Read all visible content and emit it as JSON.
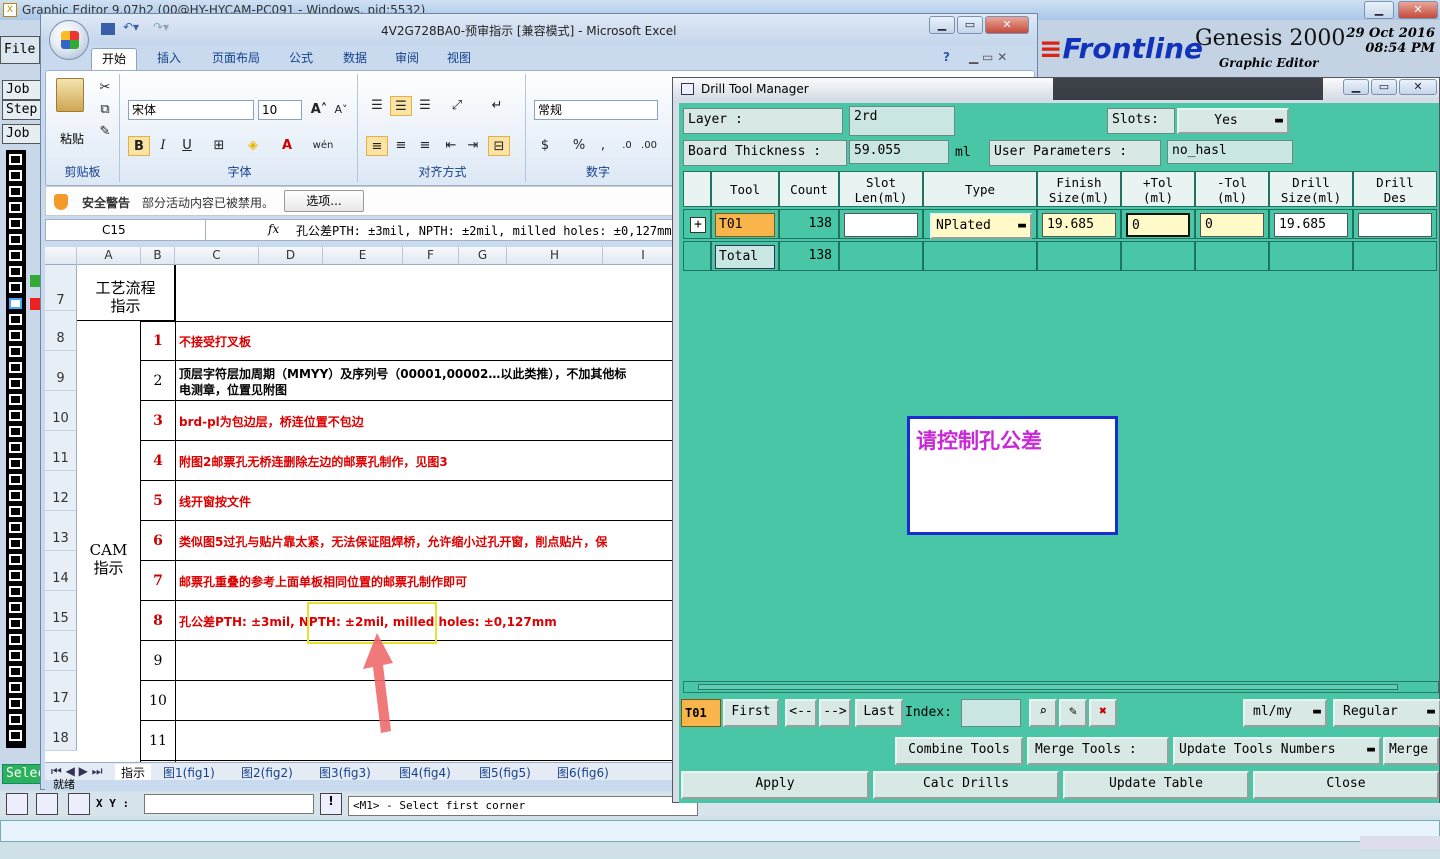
{
  "genesis": {
    "title": "Graphic Editor 9.07h2 (00@HY-HYCAM-PC091 - Windows, pid:5532)",
    "left_buttons": [
      "File",
      "Job",
      "Step",
      "Job",
      "Selec"
    ],
    "logo_brand": "Frontline",
    "logo_product": "Genesis 2000",
    "logo_sub": "Graphic Editor",
    "date": "29 Oct 2016",
    "time": "08:54 PM",
    "xy_label": "X Y :",
    "message": "<M1> - Select first corner"
  },
  "excel": {
    "title": "4V2G728BA0-预审指示 [兼容模式] - Microsoft Excel",
    "tabs": [
      "开始",
      "插入",
      "页面布局",
      "公式",
      "数据",
      "审阅",
      "视图"
    ],
    "ribbon": {
      "paste": "粘贴",
      "font_name": "宋体",
      "font_size": "10",
      "number_format": "常规",
      "groups": [
        "剪贴板",
        "字体",
        "对齐方式",
        "数字"
      ]
    },
    "security": {
      "label": "安全警告",
      "message": "部分活动内容已被禁用。",
      "options": "选项..."
    },
    "name_box": "C15",
    "formula": "孔公差PTH: ±3mil, NPTH: ±2mil, milled holes: ±0,127mm",
    "columns": [
      "A",
      "B",
      "C",
      "D",
      "E",
      "F",
      "G",
      "H",
      "I"
    ],
    "rows": [
      {
        "n": "7",
        "num": "",
        "text": ""
      },
      {
        "n": "8",
        "num": "1",
        "text": "不接受打叉板"
      },
      {
        "n": "9",
        "num": "2",
        "text": "顶层字符层加周期（MMYY）及序列号（00001,00002…以此类推），不加其他标",
        "text2": "电测章，位置见附图"
      },
      {
        "n": "10",
        "num": "3",
        "text": "brd-pl为包边层，桥连位置不包边"
      },
      {
        "n": "11",
        "num": "4",
        "text": "附图2邮票孔无桥连删除左边的邮票孔制作，见图3"
      },
      {
        "n": "12",
        "num": "5",
        "text": "线开窗按文件"
      },
      {
        "n": "13",
        "num": "6",
        "text": "类似图5过孔与贴片靠太紧，无法保证阻焊桥，允许缩小过孔开窗，削点贴片，保"
      },
      {
        "n": "14",
        "num": "7",
        "text": "邮票孔重叠的参考上面单板相同位置的邮票孔制作即可"
      },
      {
        "n": "15",
        "num": "8",
        "text": "孔公差PTH: ±3mil,  NPTH: ±2mil,  milled holes: ±0,127mm"
      },
      {
        "n": "16",
        "num": "9",
        "text": ""
      },
      {
        "n": "17",
        "num": "10",
        "text": ""
      },
      {
        "n": "18",
        "num": "11",
        "text": ""
      }
    ],
    "header_cell": "工艺流程\n指示",
    "cam_cell": "CAM\n指示",
    "sheet_tabs": [
      "指示",
      "图1(fig1)",
      "图2(fig2)",
      "图3(fig3)",
      "图4(fig4)",
      "图5(fig5)",
      "图6(fig6)"
    ],
    "status": "就绪"
  },
  "drill": {
    "title": "Drill Tool Manager",
    "layer_label": "Layer        :",
    "layer_value": "2rd",
    "slots_label": "Slots:",
    "slots_value": "Yes",
    "board_label": "Board Thickness :",
    "board_value": "59.055",
    "board_unit": "ml",
    "user_params_label": "User Parameters :",
    "user_params_value": "no_hasl",
    "headers": [
      "Tool",
      "Count",
      "Slot\nLen(ml)",
      "Type",
      "Finish\nSize(ml)",
      "+Tol\n(ml)",
      "-Tol\n(ml)",
      "Drill\nSize(ml)",
      "Drill\nDes"
    ],
    "row": {
      "tool": "T01",
      "count": "138",
      "slot_len": "",
      "type": "NPlated",
      "finish": "19.685",
      "plus_tol": "0",
      "minus_tol": "0",
      "drill_size": "19.685",
      "drill_des": ""
    },
    "total": {
      "label": "Total",
      "count": "138"
    },
    "memo": "请控制孔公差",
    "nav": {
      "current": "T01",
      "first": "First",
      "prev": "<--",
      "next": "-->",
      "last": "Last",
      "index_label": "Index:",
      "units": "ml/my",
      "mode": "Regular"
    },
    "actions1": [
      "Combine Tools",
      "Merge Tools :",
      "Update Tools Numbers",
      "Merge"
    ],
    "actions2": [
      "Apply",
      "Calc Drills",
      "Update Table",
      "Close"
    ]
  }
}
